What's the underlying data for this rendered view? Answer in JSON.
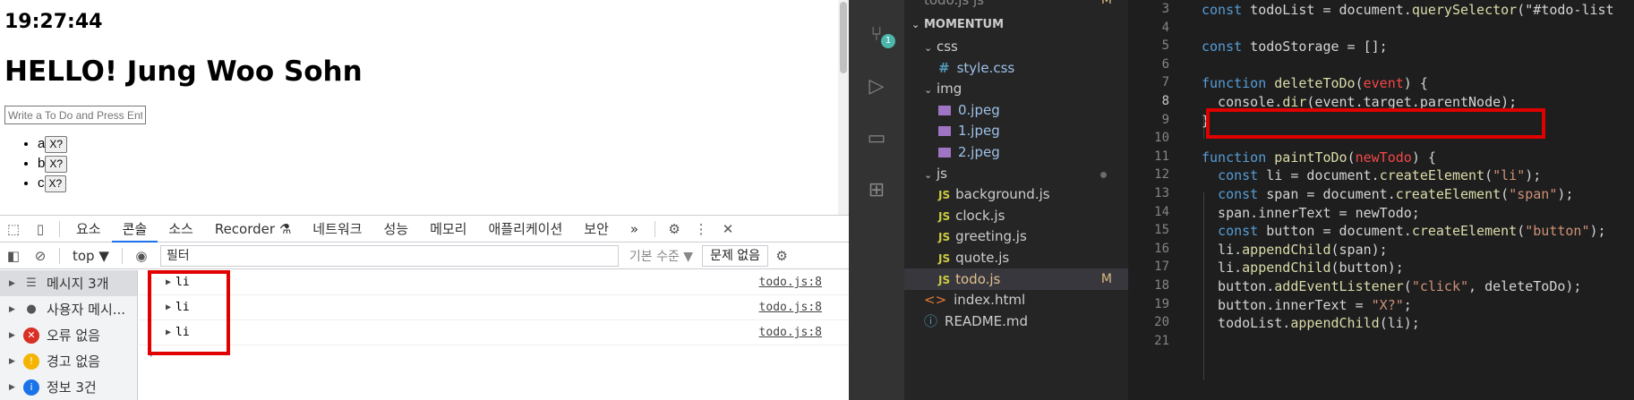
{
  "browser": {
    "clock": "19:27:44",
    "greeting": "HELLO! Jung Woo Sohn",
    "todo_placeholder": "Write a To Do and Press Enter",
    "todo_items": [
      {
        "text": "a",
        "button": "X?"
      },
      {
        "text": "b",
        "button": "X?"
      },
      {
        "text": "c",
        "button": "X?"
      }
    ]
  },
  "devtools": {
    "tabs": [
      "요소",
      "콘솔",
      "소스",
      "Recorder ⚗",
      "네트워크",
      "성능",
      "메모리",
      "애플리케이션",
      "보안"
    ],
    "active_tab": "콘솔",
    "more": "»",
    "context": "top ▼",
    "filter_placeholder": "필터",
    "levels": "기본 수준 ▼",
    "issues": "문제 없음",
    "sidebar": [
      {
        "label": "메시지 3개",
        "icon": "list-icon",
        "color": "#555555"
      },
      {
        "label": "사용자 메시...",
        "icon": "user-icon",
        "color": "#555555"
      },
      {
        "label": "오류 없음",
        "icon": "error-icon",
        "color": "#d93025"
      },
      {
        "label": "경고 없음",
        "icon": "warning-icon",
        "color": "#f4b400"
      },
      {
        "label": "정보 3건",
        "icon": "info-icon",
        "color": "#1a73e8"
      }
    ],
    "logs": [
      {
        "value": "li",
        "source": "todo.js:8"
      },
      {
        "value": "li",
        "source": "todo.js:8"
      },
      {
        "value": "li",
        "source": "todo.js:8"
      }
    ],
    "prompt": "›"
  },
  "vscode": {
    "scm_badge": "1",
    "explorer": {
      "top_tab": "todo.js  js",
      "top_tab_flag": "M",
      "root": "MOMENTUM",
      "items": [
        {
          "type": "folder",
          "label": "css",
          "indent": 1
        },
        {
          "type": "css",
          "label": "style.css",
          "indent": 2
        },
        {
          "type": "folder",
          "label": "img",
          "indent": 1
        },
        {
          "type": "img",
          "label": "0.jpeg",
          "indent": 2
        },
        {
          "type": "img",
          "label": "1.jpeg",
          "indent": 2
        },
        {
          "type": "img",
          "label": "2.jpeg",
          "indent": 2
        },
        {
          "type": "folder",
          "label": "js",
          "indent": 1
        },
        {
          "type": "js",
          "label": "background.js",
          "indent": 2
        },
        {
          "type": "js",
          "label": "clock.js",
          "indent": 2
        },
        {
          "type": "js",
          "label": "greeting.js",
          "indent": 2
        },
        {
          "type": "js",
          "label": "quote.js",
          "indent": 2
        },
        {
          "type": "js",
          "label": "todo.js",
          "indent": 2,
          "flag": "M"
        },
        {
          "type": "html",
          "label": "index.html",
          "indent": 1
        },
        {
          "type": "info",
          "label": "README.md",
          "indent": 1
        }
      ]
    },
    "editor": {
      "lines": [
        {
          "n": "3",
          "code": "const todoList = document.querySelector(\"#todo-list"
        },
        {
          "n": "4",
          "code": ""
        },
        {
          "n": "5",
          "code": "const todoStorage = [];"
        },
        {
          "n": "6",
          "code": ""
        },
        {
          "n": "7",
          "code": "function deleteToDo(event) {"
        },
        {
          "n": "8",
          "code": "  console.dir(event.target.parentNode);"
        },
        {
          "n": "9",
          "code": "}"
        },
        {
          "n": "10",
          "code": ""
        },
        {
          "n": "11",
          "code": "function paintToDo(newTodo) {"
        },
        {
          "n": "12",
          "code": "  const li = document.createElement(\"li\");"
        },
        {
          "n": "13",
          "code": "  const span = document.createElement(\"span\");"
        },
        {
          "n": "14",
          "code": "  span.innerText = newTodo;"
        },
        {
          "n": "15",
          "code": "  const button = document.createElement(\"button\");"
        },
        {
          "n": "16",
          "code": "  li.appendChild(span);"
        },
        {
          "n": "17",
          "code": "  li.appendChild(button);"
        },
        {
          "n": "18",
          "code": "  button.addEventListener(\"click\", deleteToDo);"
        },
        {
          "n": "19",
          "code": "  button.innerText = \"X?\";"
        },
        {
          "n": "20",
          "code": "  todoList.appendChild(li);"
        },
        {
          "n": "21",
          "code": ""
        }
      ],
      "current_line": "8"
    }
  }
}
